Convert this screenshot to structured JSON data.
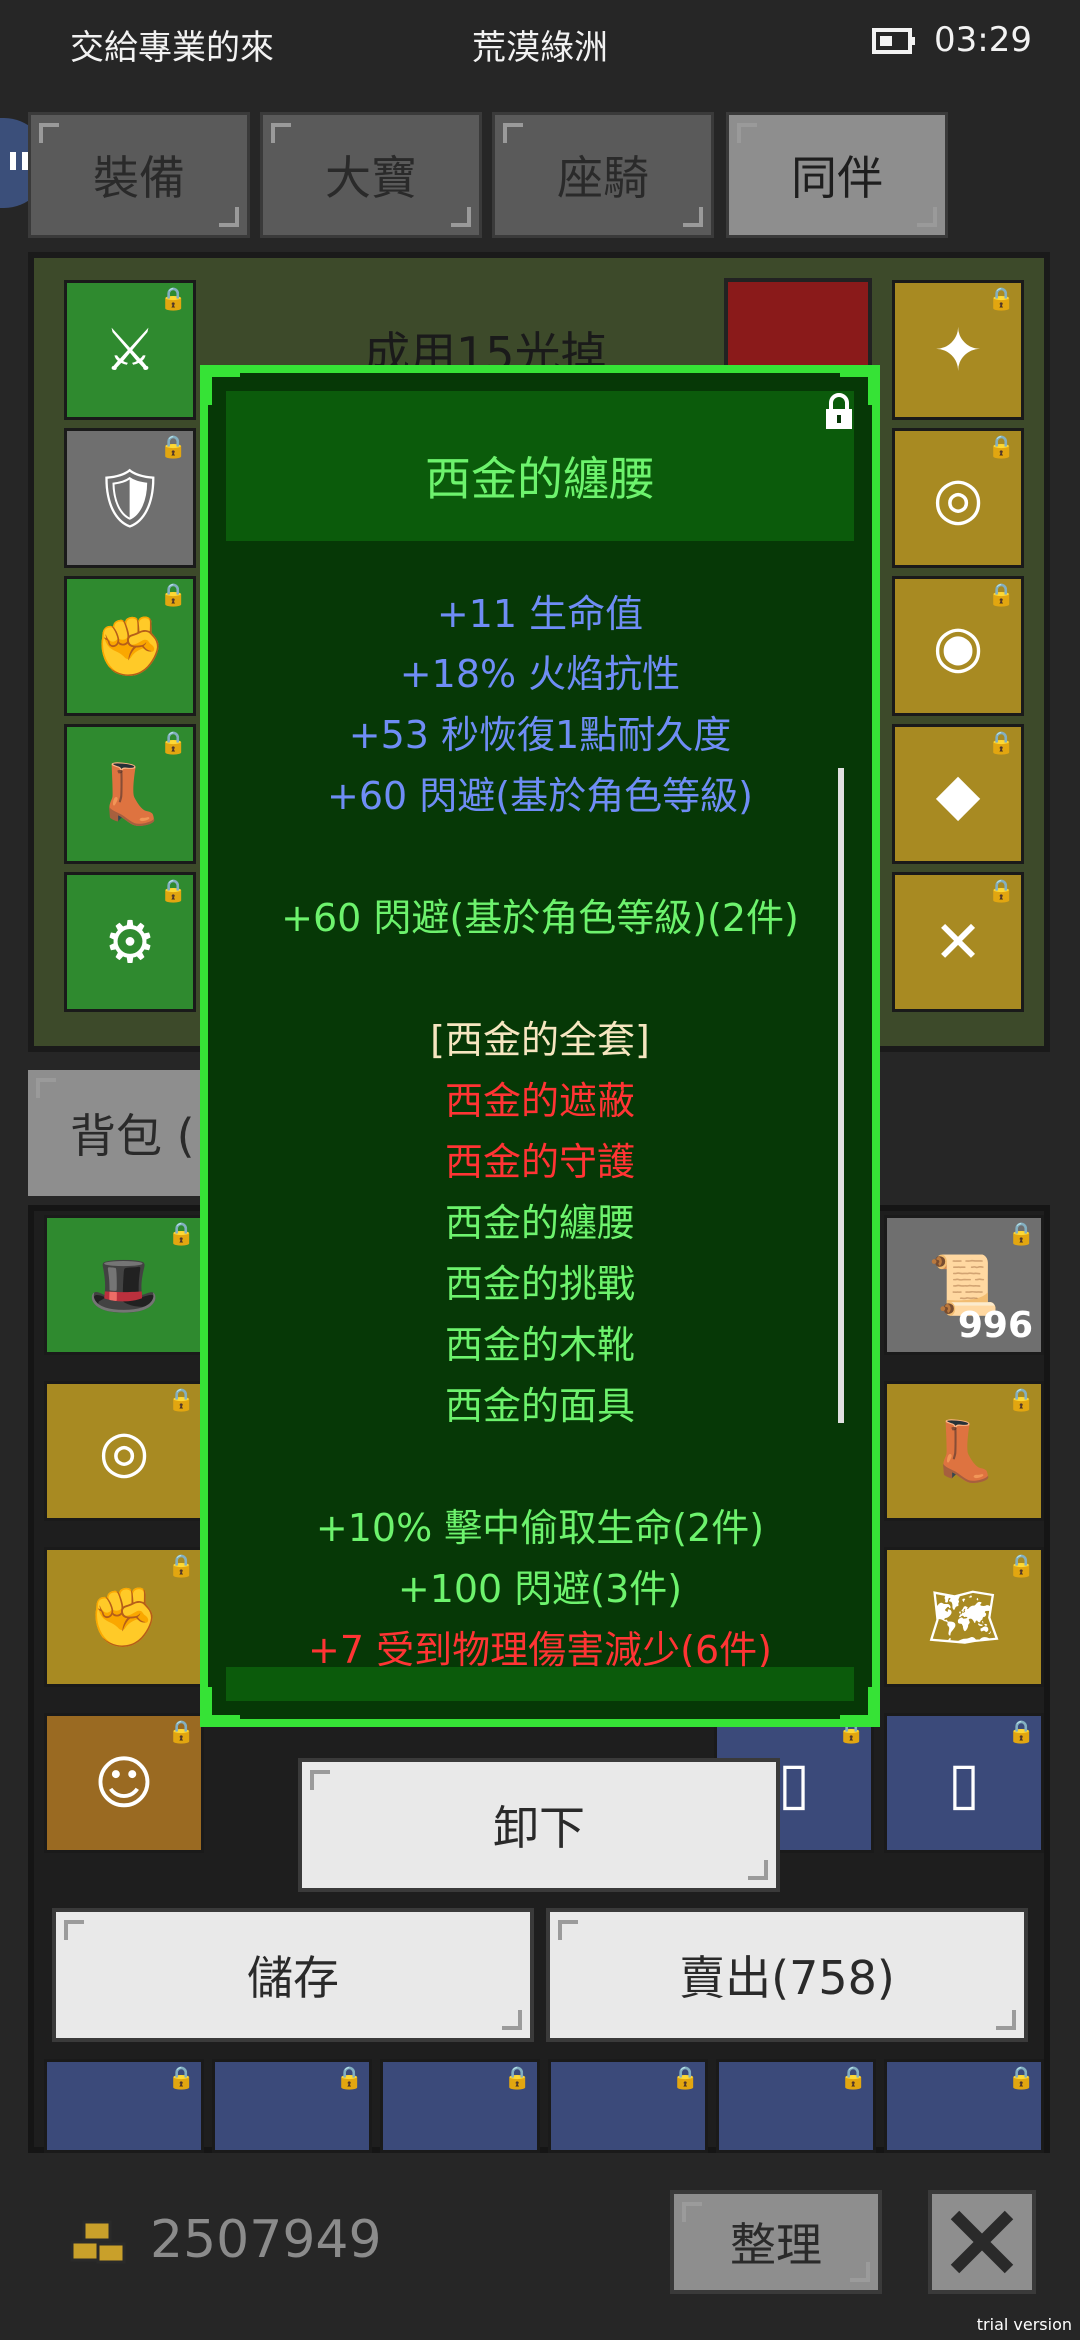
{
  "status_bar": {
    "left_text": "交給專業的來",
    "center_text": "荒漠綠洲",
    "time": "03:29",
    "battery_icon": "battery-icon"
  },
  "tabs": [
    {
      "label": "裝備",
      "active": false
    },
    {
      "label": "大寶",
      "active": false
    },
    {
      "label": "座騎",
      "active": false
    },
    {
      "label": "同伴",
      "active": true
    }
  ],
  "equip_banner_text": "成用15光掉",
  "bag_tab_label": "背包 (",
  "tooltip": {
    "title": "西金的纏腰",
    "stats": [
      "+11 生命值",
      "+18% 火焰抗性",
      "+53 秒恢復1點耐久度",
      "+60 閃避(基於角色等級)"
    ],
    "set_bonus_line": "+60 閃避(基於角色等級)(2件)",
    "set_name": "[西金的全套]",
    "set_items": [
      {
        "name": "西金的遮蔽",
        "owned": false
      },
      {
        "name": "西金的守護",
        "owned": false
      },
      {
        "name": "西金的纏腰",
        "owned": true
      },
      {
        "name": "西金的挑戰",
        "owned": true
      },
      {
        "name": "西金的木靴",
        "owned": true
      },
      {
        "name": "西金的面具",
        "owned": true
      }
    ],
    "set_bonuses": [
      {
        "text": "+10% 擊中偷取生命(2件)",
        "active": true
      },
      {
        "text": "+100 閃避(3件)",
        "active": true
      },
      {
        "text": "+7 受到物理傷害減少(6件)",
        "active": false
      }
    ]
  },
  "buttons": {
    "unequip": "卸下",
    "store": "儲存",
    "sell": "賣出(758)",
    "sort": "整理"
  },
  "bag_item_count": "996",
  "gold": "2507949",
  "watermark": "trial version",
  "colors": {
    "tooltip_border": "#36e336",
    "stat_blue": "#6f8df5",
    "set_green": "#6df36d",
    "set_red": "#ff3434"
  }
}
